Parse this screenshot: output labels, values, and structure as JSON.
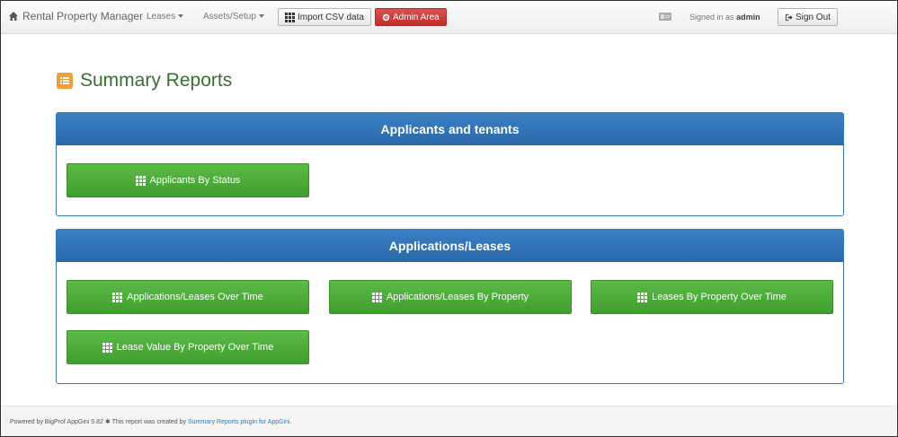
{
  "navbar": {
    "brand": "Rental Property Manager",
    "menus": [
      {
        "label": "Leases"
      },
      {
        "label": "Assets/Setup"
      }
    ],
    "import_csv": "Import CSV data",
    "admin_area": "Admin Area",
    "signed_in_prefix": "Signed in as",
    "username": "admin",
    "sign_out": "Sign Out"
  },
  "page": {
    "title": "Summary Reports"
  },
  "sections": [
    {
      "heading": "Applicants and tenants",
      "reports": [
        "Applicants By Status"
      ]
    },
    {
      "heading": "Applications/Leases",
      "reports": [
        "Applications/Leases Over Time",
        "Applications/Leases By Property",
        "Leases By Property Over Time",
        "Lease Value By Property Over Time"
      ]
    }
  ],
  "footer": {
    "powered_prefix": "Powered by BigProf AppGini 5.82",
    "report_text": "This report was created by",
    "plugin_link": "Summary Reports plugin for AppGini."
  },
  "colors": {
    "panel_heading": "#2a6fb4",
    "report_button": "#4cae3c",
    "admin_button": "#d9534f",
    "title": "#3b6e35",
    "title_icon": "#f0a030"
  }
}
